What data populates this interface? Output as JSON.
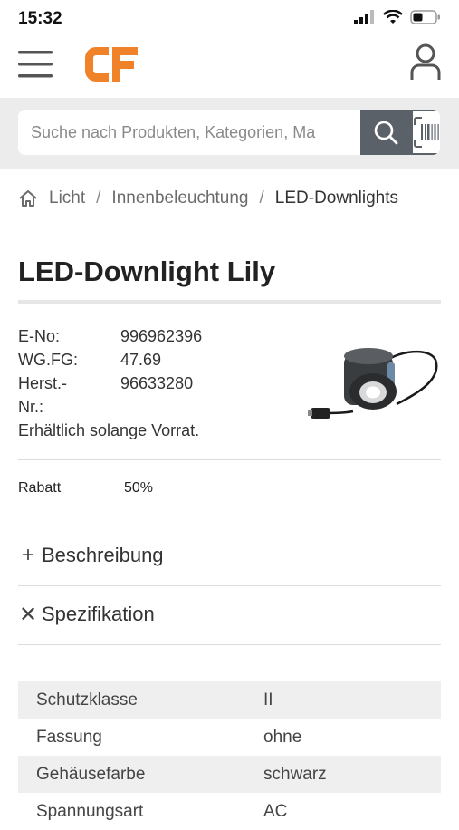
{
  "status_bar": {
    "time": "15:32"
  },
  "brand": {
    "logo_text": "CF",
    "accent_color": "#f0822a"
  },
  "search": {
    "placeholder": "Suche nach Produkten, Kategorien, Ma"
  },
  "breadcrumb": [
    {
      "label": "Licht"
    },
    {
      "label": "Innenbeleuchtung"
    },
    {
      "label": "LED-Downlights"
    }
  ],
  "product": {
    "title": "LED-Downlight Lily",
    "info": [
      {
        "key": "E-No:",
        "value": "996962396"
      },
      {
        "key": "WG.FG:",
        "value": "47.69"
      },
      {
        "key": "Herst.-Nr.:",
        "key_line1": "Herst.-",
        "key_line2": "Nr.:",
        "value": "96633280"
      }
    ],
    "availability": "Erhältlich solange Vorrat.",
    "rabatt_label": "Rabatt",
    "rabatt_value": "50%"
  },
  "accordions": [
    {
      "label": "Beschreibung",
      "icon": "plus-icon",
      "icon_char": "+"
    },
    {
      "label": "Spezifikation",
      "icon": "close-icon",
      "icon_char": "✕"
    }
  ],
  "specifications": [
    {
      "name": "Schutzklasse",
      "value": "II"
    },
    {
      "name": "Fassung",
      "value": "ohne"
    },
    {
      "name": "Gehäusefarbe",
      "value": "schwarz"
    },
    {
      "name": "Spannungsart",
      "value": "AC"
    }
  ],
  "colors": {
    "search_button": "#5b6169",
    "band_bg": "#ececec"
  }
}
